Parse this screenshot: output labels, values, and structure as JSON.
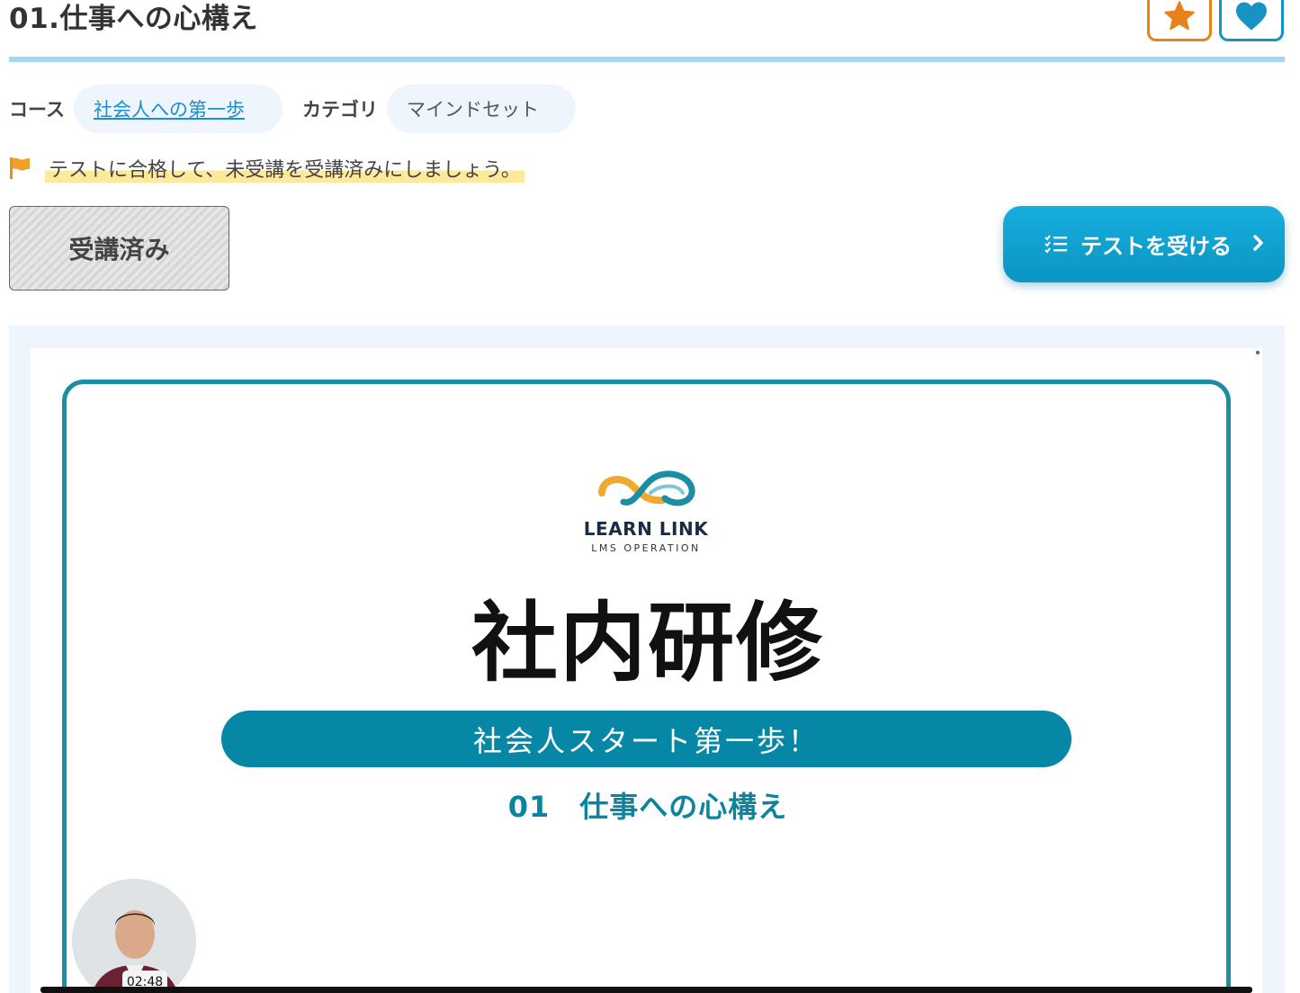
{
  "header": {
    "title": "01.仕事への心構え",
    "star_icon": "star-icon",
    "heart_icon": "heart-icon"
  },
  "meta": {
    "course_label": "コース",
    "course_value": "社会人への第一歩",
    "category_label": "カテゴリ",
    "category_value": "マインドセット"
  },
  "notice": {
    "icon": "flag-icon",
    "text": "テストに合格して、未受講を受講済みにしましょう。"
  },
  "actions": {
    "completed_label": "受講済み",
    "take_test_label": "テストを受ける"
  },
  "video": {
    "brand_name": "LEARN LINK",
    "brand_tagline": "LMS OPERATION",
    "main_title": "社内研修",
    "banner_text": "社会人スタート第一歩！",
    "lesson_title": "01　仕事への心構え",
    "timestamp": "02:48"
  },
  "colors": {
    "accent_orange": "#e8821a",
    "accent_blue": "#1593c4",
    "teal": "#0587a5",
    "rule_blue": "#a8d4f5"
  }
}
